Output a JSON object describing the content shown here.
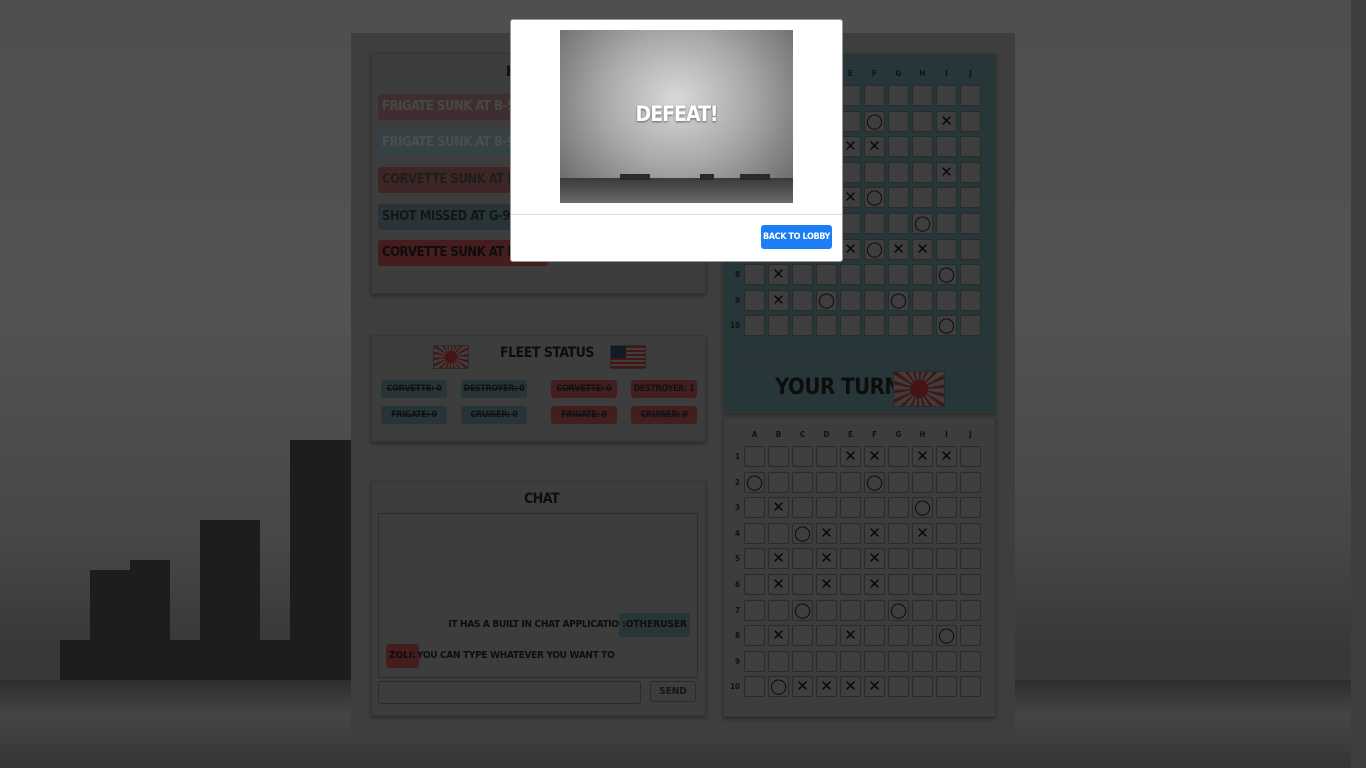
{
  "battle_log": {
    "title_fragment": "B",
    "entries": [
      {
        "text": "Frigate sunk at B-5",
        "color": "#7f5d5e"
      },
      {
        "text": "Frigate sunk at B-9",
        "color": "#6b8288"
      },
      {
        "text": "Corvette sunk at B-8",
        "color": "#7c4c4d"
      },
      {
        "text": "Shot missed at G-9",
        "color": "#4e6b72"
      },
      {
        "text": "Corvette sunk at E-8",
        "color": "#8a3b3c"
      }
    ]
  },
  "fleet_status": {
    "title": "Fleet Status",
    "left_flag": "japan-flag",
    "right_flag": "usa-flag",
    "player": [
      {
        "label": "Corvette: 0"
      },
      {
        "label": "Destroyer: 0"
      },
      {
        "label": "Frigate: 0"
      },
      {
        "label": "Cruiser: 0"
      }
    ],
    "enemy": [
      {
        "label": "Corvette: 0"
      },
      {
        "label": "Destroyer: 1"
      },
      {
        "label": "Frigate: 0"
      },
      {
        "label": "Cruiser: 0"
      }
    ]
  },
  "chat": {
    "title": "Chat",
    "messages": [
      {
        "user": ":otheruser",
        "text": "It has a built in chat application",
        "side": "right"
      },
      {
        "user": "zoli:",
        "text": "you can type whatever you want to",
        "side": "left"
      }
    ],
    "input_value": "",
    "send_label": "Send"
  },
  "turn": {
    "label": "Your Turn!",
    "flag": "japan-flag"
  },
  "columns": [
    "A",
    "B",
    "C",
    "D",
    "E",
    "F",
    "G",
    "H",
    "I",
    "J"
  ],
  "rows": [
    "1",
    "2",
    "3",
    "4",
    "5",
    "6",
    "7",
    "8",
    "9",
    "10"
  ],
  "top_board": {
    "visible_columns": [
      "E",
      "F",
      "G",
      "H",
      "I",
      "J"
    ],
    "marks": [
      {
        "row": 2,
        "col": "F",
        "mark": "O"
      },
      {
        "row": 2,
        "col": "I",
        "mark": "X"
      },
      {
        "row": 3,
        "col": "E",
        "mark": "X"
      },
      {
        "row": 3,
        "col": "F",
        "mark": "X"
      },
      {
        "row": 4,
        "col": "I",
        "mark": "X"
      },
      {
        "row": 5,
        "col": "E",
        "mark": "X"
      },
      {
        "row": 5,
        "col": "F",
        "mark": "O"
      },
      {
        "row": 6,
        "col": "H",
        "mark": "O"
      },
      {
        "row": 7,
        "col": "E",
        "mark": "X"
      },
      {
        "row": 7,
        "col": "F",
        "mark": "O"
      },
      {
        "row": 7,
        "col": "G",
        "mark": "X"
      },
      {
        "row": 7,
        "col": "H",
        "mark": "X"
      },
      {
        "row": 8,
        "col": "B",
        "mark": "X"
      },
      {
        "row": 8,
        "col": "I",
        "mark": "O"
      },
      {
        "row": 9,
        "col": "B",
        "mark": "X"
      },
      {
        "row": 9,
        "col": "D",
        "mark": "O"
      },
      {
        "row": 9,
        "col": "G",
        "mark": "O"
      },
      {
        "row": 10,
        "col": "I",
        "mark": "O"
      }
    ]
  },
  "bottom_board": {
    "marks": [
      {
        "row": 1,
        "col": "E",
        "mark": "X"
      },
      {
        "row": 1,
        "col": "F",
        "mark": "X"
      },
      {
        "row": 1,
        "col": "H",
        "mark": "X"
      },
      {
        "row": 1,
        "col": "I",
        "mark": "X"
      },
      {
        "row": 2,
        "col": "A",
        "mark": "O"
      },
      {
        "row": 2,
        "col": "F",
        "mark": "O"
      },
      {
        "row": 3,
        "col": "B",
        "mark": "X"
      },
      {
        "row": 3,
        "col": "H",
        "mark": "O"
      },
      {
        "row": 4,
        "col": "C",
        "mark": "O"
      },
      {
        "row": 4,
        "col": "D",
        "mark": "X"
      },
      {
        "row": 4,
        "col": "F",
        "mark": "X"
      },
      {
        "row": 4,
        "col": "H",
        "mark": "X"
      },
      {
        "row": 5,
        "col": "B",
        "mark": "X"
      },
      {
        "row": 5,
        "col": "D",
        "mark": "X"
      },
      {
        "row": 5,
        "col": "F",
        "mark": "X"
      },
      {
        "row": 6,
        "col": "B",
        "mark": "X"
      },
      {
        "row": 6,
        "col": "D",
        "mark": "X"
      },
      {
        "row": 6,
        "col": "F",
        "mark": "X"
      },
      {
        "row": 7,
        "col": "C",
        "mark": "O"
      },
      {
        "row": 7,
        "col": "G",
        "mark": "O"
      },
      {
        "row": 8,
        "col": "B",
        "mark": "X"
      },
      {
        "row": 8,
        "col": "E",
        "mark": "X"
      },
      {
        "row": 8,
        "col": "I",
        "mark": "O"
      },
      {
        "row": 10,
        "col": "B",
        "mark": "O"
      },
      {
        "row": 10,
        "col": "C",
        "mark": "X"
      },
      {
        "row": 10,
        "col": "D",
        "mark": "X"
      },
      {
        "row": 10,
        "col": "E",
        "mark": "X"
      },
      {
        "row": 10,
        "col": "F",
        "mark": "X"
      }
    ]
  },
  "modal": {
    "heading": "Defeat!",
    "button_label": "Back to lobby",
    "button_color": "#1b7ef5"
  },
  "colors": {
    "overlay": "rgba(0,0,0,0.5)",
    "board_bg": "#4f6c73"
  }
}
